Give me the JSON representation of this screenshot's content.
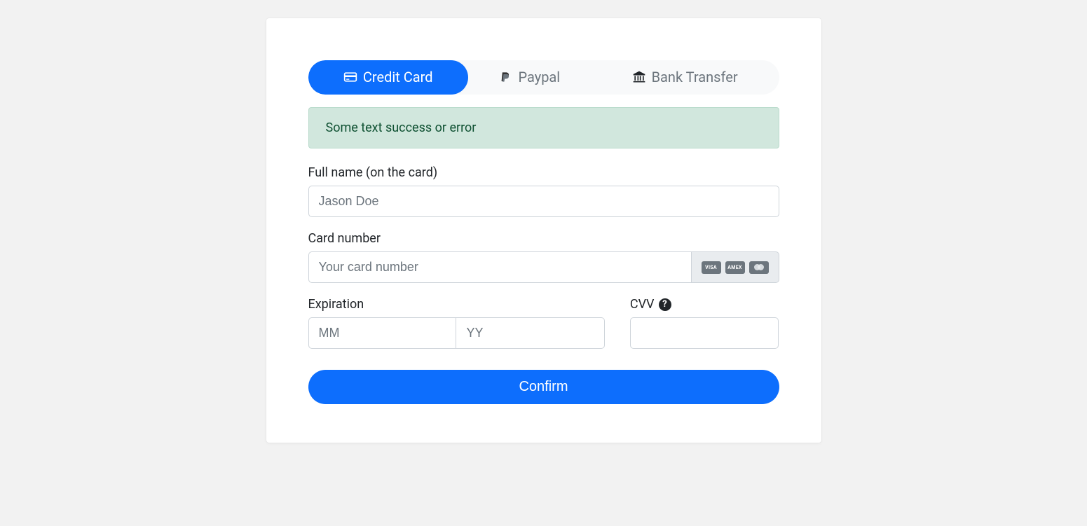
{
  "tabs": {
    "credit_card": "Credit Card",
    "paypal": "Paypal",
    "bank_transfer": "Bank Transfer"
  },
  "alert": {
    "message": "Some text success or error"
  },
  "fields": {
    "full_name": {
      "label": "Full name (on the card)",
      "placeholder": "Jason Doe",
      "value": ""
    },
    "card_number": {
      "label": "Card number",
      "placeholder": "Your card number",
      "value": ""
    },
    "expiration": {
      "label": "Expiration",
      "mm_placeholder": "MM",
      "yy_placeholder": "YY",
      "mm_value": "",
      "yy_value": ""
    },
    "cvv": {
      "label": "CVV",
      "value": ""
    }
  },
  "card_brands": {
    "visa": "VISA",
    "amex": "AMEX"
  },
  "buttons": {
    "confirm": "Confirm"
  }
}
